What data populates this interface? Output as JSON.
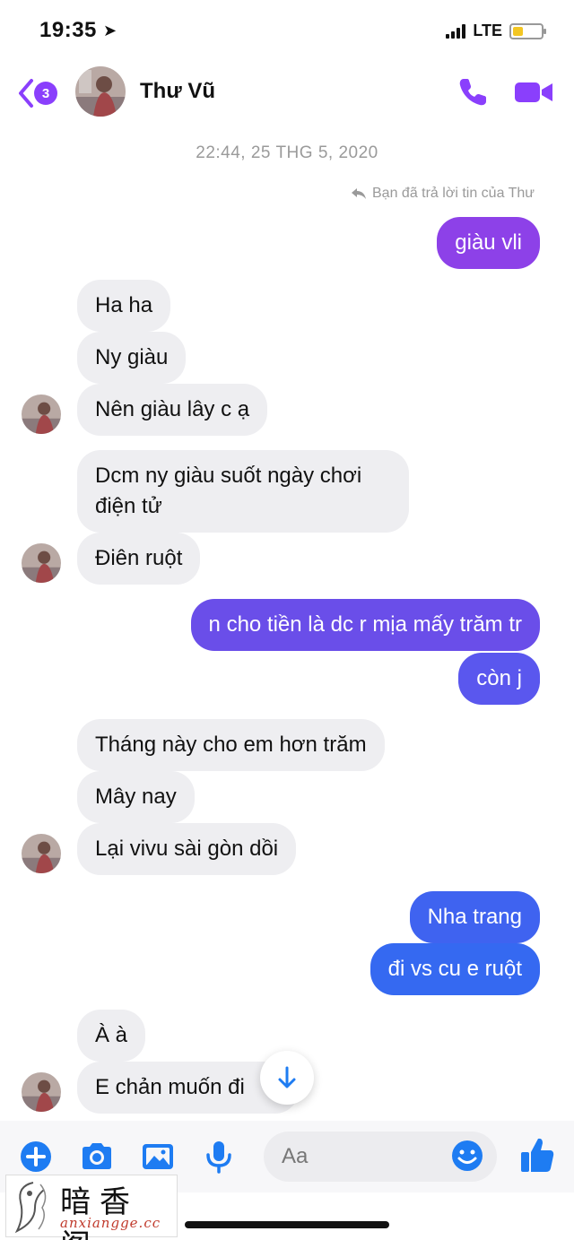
{
  "status_bar": {
    "time": "19:35",
    "location_glyph": "➤",
    "network": "LTE",
    "battery_level": 0.35
  },
  "header": {
    "unread_count": "3",
    "contact_name": "Thư Vũ"
  },
  "conversation": {
    "timestamp": "22:44, 25 THG 5, 2020",
    "reply_note": "Bạn đã trả lời tin của Thư",
    "messages": [
      {
        "side": "out",
        "text": "giàu vli"
      },
      {
        "side": "in",
        "text": "Ha ha"
      },
      {
        "side": "in",
        "text": "Ny giàu"
      },
      {
        "side": "in",
        "text": "Nên giàu lây c ạ"
      },
      {
        "side": "in",
        "text": "Dcm ny giàu suốt ngày chơi điện tử"
      },
      {
        "side": "in",
        "text": "Điên ruột"
      },
      {
        "side": "out",
        "text": "n cho tiền là dc r mịa mấy trăm tr"
      },
      {
        "side": "out",
        "text": "còn j"
      },
      {
        "side": "in",
        "text": "Tháng này cho em hơn trăm"
      },
      {
        "side": "in",
        "text": "Mây nay"
      },
      {
        "side": "in",
        "text": "Lại vivu sài gòn dồi"
      },
      {
        "side": "out",
        "text": "Nha trang"
      },
      {
        "side": "out",
        "text": "đi vs cu e ruột"
      },
      {
        "side": "in",
        "text": "À à"
      },
      {
        "side": "in",
        "text": "E chản muốn đi"
      }
    ]
  },
  "composer": {
    "placeholder": "Aa"
  },
  "watermark": {
    "title": "暗香阁",
    "url": "anxiangge.cc"
  },
  "colors": {
    "accent": "#8a3ffc",
    "bubble_in": "#eeeef1",
    "blue": "#1e7cf2"
  },
  "icons": [
    "back-chevron-icon",
    "phone-icon",
    "video-camera-icon",
    "reply-arrow-icon",
    "arrow-down-icon",
    "plus-icon",
    "camera-icon",
    "image-icon",
    "microphone-icon",
    "emoji-icon",
    "thumbs-up-icon"
  ]
}
